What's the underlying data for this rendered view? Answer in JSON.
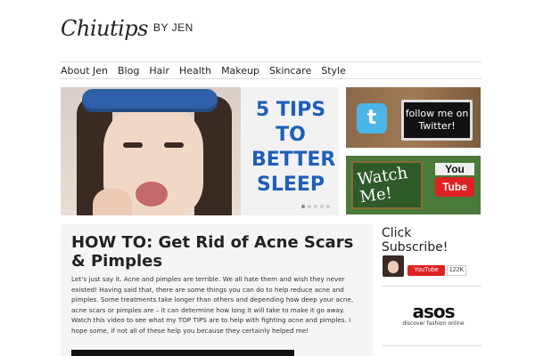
{
  "site": {
    "logo_script": "Chiutips",
    "logo_by": "BY JEN"
  },
  "nav": {
    "items": [
      "About Jen",
      "Blog",
      "Hair",
      "Health",
      "Makeup",
      "Skincare",
      "Style"
    ]
  },
  "hero": {
    "headline": "5 TIPS TO BETTER SLEEP"
  },
  "banners": {
    "twitter": {
      "screen_text": "follow me on Twitter!",
      "icon": "twitter-bird-icon"
    },
    "youtube": {
      "board_text": "Watch Me!",
      "logo_you": "You",
      "logo_tube": "Tube"
    }
  },
  "post": {
    "title": "HOW TO: Get Rid of Acne Scars & Pimples",
    "body": "Let’s just say it.  Acne and pimples are terrible.  We all hate them and wish they never existed!  Having said that, there are some things you can do to help reduce acne and pimples.  Some treatments take longer than others and depending how deep your acne, acne scars or pimples are – it can determine how long it will take to make it go away.  Watch this video to see what my TOP TIPS are to help with fighting acne and pimples.  I hope some, if not all of these help you because they certainly helped me!"
  },
  "sidebar": {
    "title": "Click Subscribe!",
    "subscribe_label": "YouTube",
    "subscriber_count": "122K",
    "asos_word": "asos",
    "asos_tagline": "discover fashion online"
  },
  "colors": {
    "accent_blue": "#1e5fb8",
    "youtube_red": "#dd2222",
    "twitter_blue": "#4db6e8"
  }
}
